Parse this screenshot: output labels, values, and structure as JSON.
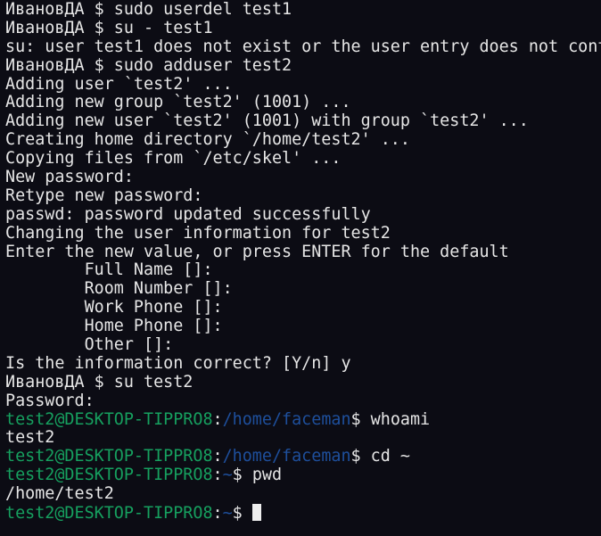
{
  "terminal": {
    "colors": {
      "background": "#0c0c14",
      "text": "#e6e6e6",
      "prompt_user": "#16a05f",
      "prompt_path": "#1e4f9c"
    },
    "lines": [
      [
        {
          "t": "ИвановДА $ sudo userdel test1",
          "c": "w"
        }
      ],
      [
        {
          "t": "ИвановДА $ su - test1",
          "c": "w"
        }
      ],
      [
        {
          "t": "su: user test1 does not exist or the user entry does not cont",
          "c": "w"
        }
      ],
      [
        {
          "t": "ИвановДА $ sudo adduser test2",
          "c": "w"
        }
      ],
      [
        {
          "t": "Adding user `test2' ...",
          "c": "w"
        }
      ],
      [
        {
          "t": "Adding new group `test2' (1001) ...",
          "c": "w"
        }
      ],
      [
        {
          "t": "Adding new user `test2' (1001) with group `test2' ...",
          "c": "w"
        }
      ],
      [
        {
          "t": "Creating home directory `/home/test2' ...",
          "c": "w"
        }
      ],
      [
        {
          "t": "Copying files from `/etc/skel' ...",
          "c": "w"
        }
      ],
      [
        {
          "t": "New password:",
          "c": "w"
        }
      ],
      [
        {
          "t": "Retype new password:",
          "c": "w"
        }
      ],
      [
        {
          "t": "passwd: password updated successfully",
          "c": "w"
        }
      ],
      [
        {
          "t": "Changing the user information for test2",
          "c": "w"
        }
      ],
      [
        {
          "t": "Enter the new value, or press ENTER for the default",
          "c": "w"
        }
      ],
      [
        {
          "t": "        Full Name []:",
          "c": "w"
        }
      ],
      [
        {
          "t": "        Room Number []:",
          "c": "w"
        }
      ],
      [
        {
          "t": "        Work Phone []:",
          "c": "w"
        }
      ],
      [
        {
          "t": "        Home Phone []:",
          "c": "w"
        }
      ],
      [
        {
          "t": "        Other []:",
          "c": "w"
        }
      ],
      [
        {
          "t": "Is the information correct? [Y/n] y",
          "c": "w"
        }
      ],
      [
        {
          "t": "ИвановДА $ su test2",
          "c": "w"
        }
      ],
      [
        {
          "t": "Password:",
          "c": "w"
        }
      ],
      [
        {
          "t": "test2@DESKTOP-TIPPRO8",
          "c": "g"
        },
        {
          "t": ":",
          "c": "w"
        },
        {
          "t": "/home/faceman",
          "c": "b"
        },
        {
          "t": "$ whoami",
          "c": "w"
        }
      ],
      [
        {
          "t": "test2",
          "c": "w"
        }
      ],
      [
        {
          "t": "test2@DESKTOP-TIPPRO8",
          "c": "g"
        },
        {
          "t": ":",
          "c": "w"
        },
        {
          "t": "/home/faceman",
          "c": "b"
        },
        {
          "t": "$ cd ~",
          "c": "w"
        }
      ],
      [
        {
          "t": "test2@DESKTOP-TIPPRO8",
          "c": "g"
        },
        {
          "t": ":",
          "c": "w"
        },
        {
          "t": "~",
          "c": "b"
        },
        {
          "t": "$ pwd",
          "c": "w"
        }
      ],
      [
        {
          "t": "/home/test2",
          "c": "w"
        }
      ],
      [
        {
          "t": "test2@DESKTOP-TIPPRO8",
          "c": "g"
        },
        {
          "t": ":",
          "c": "w"
        },
        {
          "t": "~",
          "c": "b"
        },
        {
          "t": "$ ",
          "c": "w"
        }
      ]
    ]
  }
}
